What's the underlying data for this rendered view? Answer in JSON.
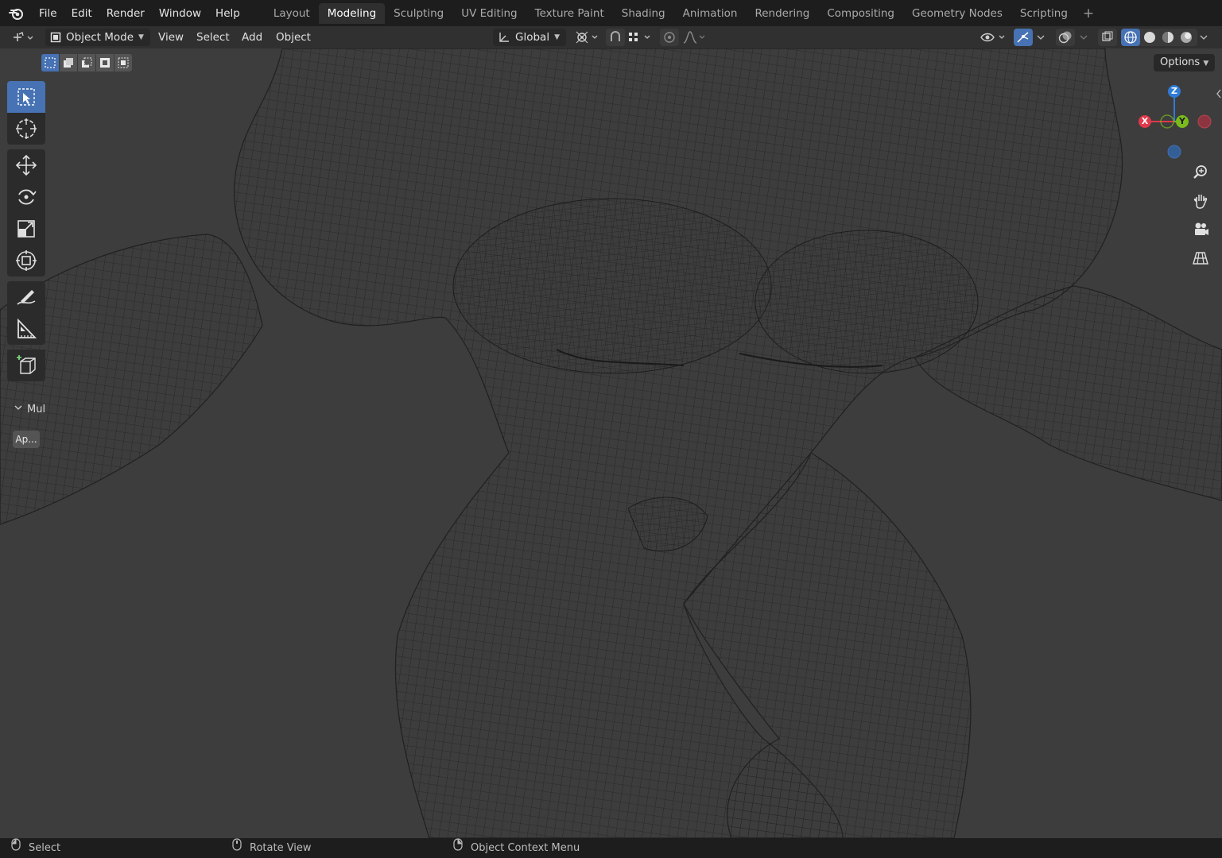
{
  "menus": [
    "File",
    "Edit",
    "Render",
    "Window",
    "Help"
  ],
  "workspace_tabs": [
    "Layout",
    "Modeling",
    "Sculpting",
    "UV Editing",
    "Texture Paint",
    "Shading",
    "Animation",
    "Rendering",
    "Compositing",
    "Geometry Nodes",
    "Scripting"
  ],
  "active_tab": "Modeling",
  "header": {
    "mode": "Object Mode",
    "view": "View",
    "select": "Select",
    "add": "Add",
    "object": "Object",
    "orientation": "Global"
  },
  "options_label": "Options",
  "last_operator": {
    "title": "Mul",
    "apply_label": "Ap..."
  },
  "gizmo": {
    "z": "Z",
    "x": "X",
    "y": "Y",
    "x_color": "#e0394b",
    "y_color": "#7bbb1c",
    "z_color": "#2f7bd6"
  },
  "status": {
    "left": "Select",
    "middle": "Rotate View",
    "right": "Object Context Menu"
  },
  "colors": {
    "accent": "#4772b3",
    "background": "#3d3d3d",
    "topbar": "#1d1d1d",
    "wire": "#1f1f1f"
  }
}
